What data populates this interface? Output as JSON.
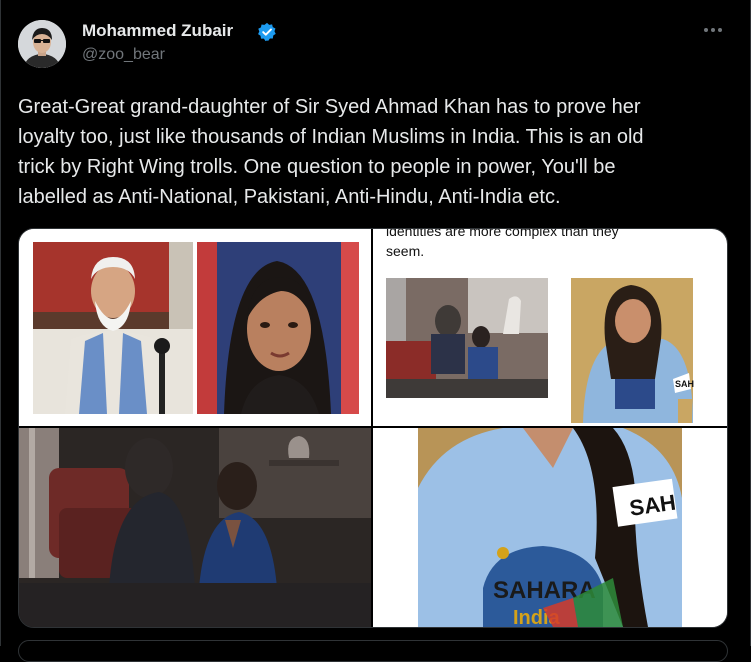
{
  "author": {
    "name": "Mohammed Zubair",
    "handle": "@zoo_bear"
  },
  "icons": {
    "verified": "verified-badge-icon",
    "more": "more-options-icon"
  },
  "colors": {
    "background": "#000000",
    "text": "#e7e9ea",
    "muted": "#71767b",
    "verified": "#1d9bf0",
    "border": "#2f3336"
  },
  "tweet": {
    "text": "Great-Great grand-daughter of Sir Syed Ahmad Khan has to prove her\nloyalty too, just like thousands of Indian Muslims in India. This is an old\ntrick by Right Wing trolls. One question to people in power, You'll be\nlabelled as Anti-National, Pakistani, Anti-Hindu, Anti-India etc."
  },
  "media": {
    "image2_caption": "identities are more complex than they\nseem.",
    "shirt_text_sleeve": "SAH",
    "shirt_text_logo": "SAHARA",
    "shirt_text_india": "India",
    "shirt_text_small": "SAH"
  }
}
